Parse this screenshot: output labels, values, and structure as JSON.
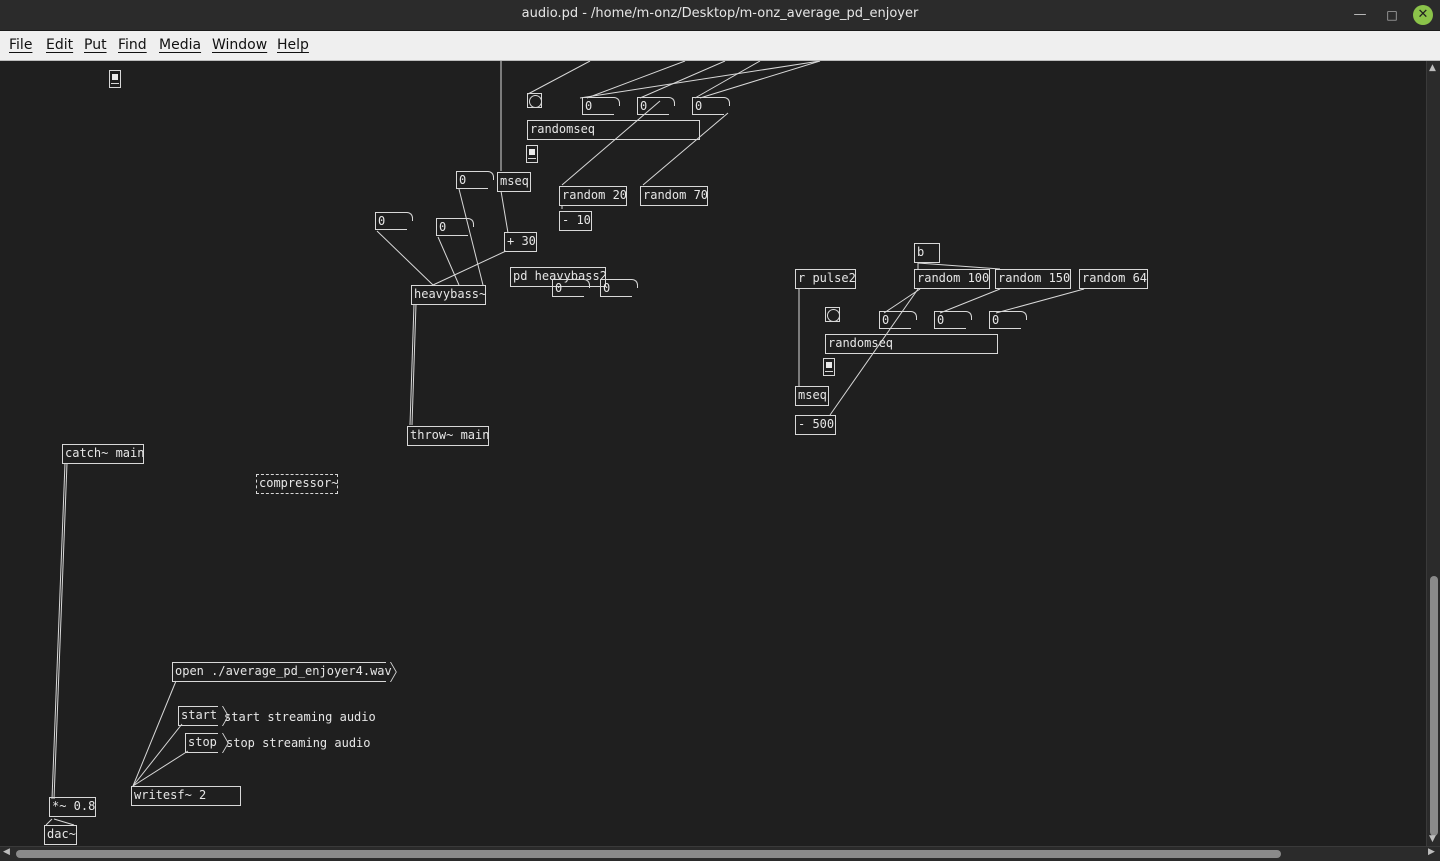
{
  "window": {
    "title": "audio.pd - /home/m-onz/Desktop/m-onz_average_pd_enjoyer",
    "minimize": "—",
    "maximize": "□",
    "close": "✕"
  },
  "menu": {
    "file": "File",
    "edit": "Edit",
    "put": "Put",
    "find": "Find",
    "media": "Media",
    "window": "Window",
    "help": "Help"
  },
  "patch": {
    "randomseq_top": "randomseq",
    "num_top_1": "0",
    "num_top_2": "0",
    "num_top_3": "0",
    "num_mseq_in": "0",
    "mseq_top": "mseq",
    "random_20": "random 20",
    "random_70": "random 70",
    "minus_10": "- 10",
    "plus_30": "+ 30",
    "num_hb_1": "0",
    "num_hb_2": "0",
    "heavybass": "heavybass~",
    "pd_heavybass2": "pd heavybass2",
    "num_pd_1": "0",
    "num_pd_2": "0",
    "throw_main": "throw~ main",
    "msg_b": "b",
    "r_pulse2": "r pulse2",
    "random_100": "random 100",
    "random_150": "random 150",
    "random_64": "random 64",
    "num_right_1": "0",
    "num_right_2": "0",
    "num_right_3": "0",
    "randomseq_right": "randomseq",
    "mseq_right": "mseq",
    "minus_500": "- 500",
    "catch_main": "catch~ main",
    "compressor": "compressor~",
    "open_msg": "open ./average_pd_enjoyer4.wav",
    "start_msg": "start",
    "start_comment": "start streaming audio",
    "stop_msg": "stop",
    "stop_comment": "stop streaming audio",
    "writesf": "writesf~ 2",
    "times_08": "*~ 0.8",
    "dac": "dac~"
  },
  "colors": {
    "canvas": "#1f1f1f",
    "foreground": "#d8d8d8",
    "menubar": "#efefef",
    "close_button": "#8bc34a"
  }
}
